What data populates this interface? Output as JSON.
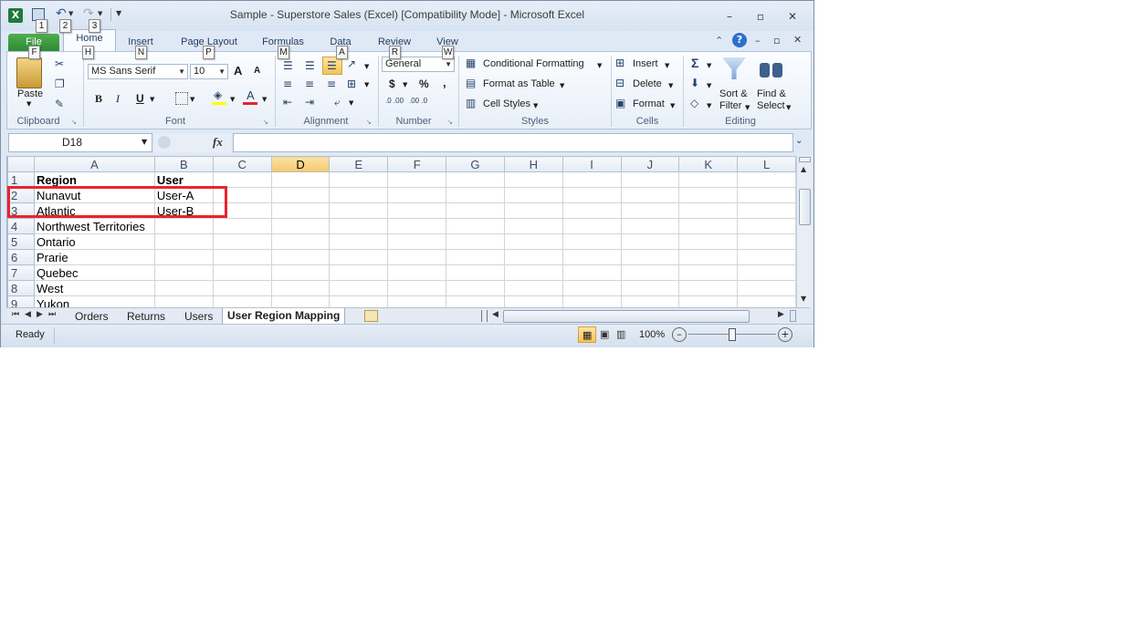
{
  "window": {
    "title": "Sample - Superstore Sales (Excel)  [Compatibility Mode]  -  Microsoft Excel"
  },
  "qat": {
    "keytips": [
      "1",
      "2",
      "3"
    ]
  },
  "tabs": [
    {
      "label": "File",
      "keytip": "F"
    },
    {
      "label": "Home",
      "keytip": "H"
    },
    {
      "label": "Insert",
      "keytip": "N"
    },
    {
      "label": "Page Layout",
      "keytip": "P"
    },
    {
      "label": "Formulas",
      "keytip": "M"
    },
    {
      "label": "Data",
      "keytip": "A"
    },
    {
      "label": "Review",
      "keytip": "R"
    },
    {
      "label": "View",
      "keytip": "W"
    }
  ],
  "ribbon": {
    "clipboard": {
      "label": "Clipboard",
      "paste": "Paste"
    },
    "font": {
      "label": "Font",
      "name": "MS Sans Serif",
      "size": "10",
      "bold": "B",
      "italic": "I",
      "underline": "U",
      "grow": "A",
      "shrink": "A",
      "color": "A"
    },
    "alignment": {
      "label": "Alignment"
    },
    "number": {
      "label": "Number",
      "format": "General",
      "currency": "$",
      "percent": "%",
      "comma": ",",
      "inc_dec": ".0 .00",
      "dec_dec": ".00 .0"
    },
    "styles": {
      "label": "Styles",
      "conditional": "Conditional Formatting",
      "format_table": "Format as Table",
      "cell_styles": "Cell Styles"
    },
    "cells": {
      "label": "Cells",
      "insert": "Insert",
      "delete": "Delete",
      "format": "Format"
    },
    "editing": {
      "label": "Editing",
      "sum": "Σ",
      "sort": "Sort &",
      "filter": "Filter",
      "find": "Find &",
      "select": "Select"
    }
  },
  "formula_bar": {
    "name_box": "D18",
    "fx": "fx",
    "formula": ""
  },
  "columns": [
    "A",
    "B",
    "C",
    "D",
    "E",
    "F",
    "G",
    "H",
    "I",
    "J",
    "K",
    "L"
  ],
  "selected_column": "D",
  "rows": [
    {
      "num": "1",
      "a": "Region",
      "b": "User"
    },
    {
      "num": "2",
      "a": "Nunavut",
      "b": "User-A"
    },
    {
      "num": "3",
      "a": "Atlantic",
      "b": "User-B"
    },
    {
      "num": "4",
      "a": "Northwest Territories",
      "b": ""
    },
    {
      "num": "5",
      "a": "Ontario",
      "b": ""
    },
    {
      "num": "6",
      "a": "Prarie",
      "b": ""
    },
    {
      "num": "7",
      "a": "Quebec",
      "b": ""
    },
    {
      "num": "8",
      "a": "West",
      "b": ""
    },
    {
      "num": "9",
      "a": "Yukon",
      "b": ""
    }
  ],
  "sheets": [
    "Orders",
    "Returns",
    "Users",
    "User Region Mapping"
  ],
  "active_sheet": "User Region Mapping",
  "status": {
    "ready": "Ready",
    "zoom": "100%"
  },
  "colors": {
    "file_tab": "#2f8a33",
    "highlight": "#e8242e",
    "selected_header": "#f7c86a"
  }
}
